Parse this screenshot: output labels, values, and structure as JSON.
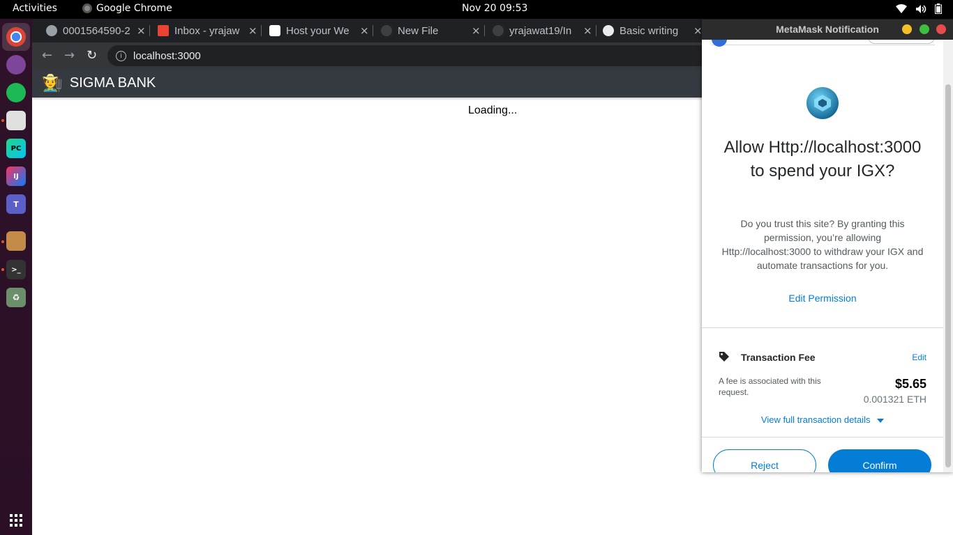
{
  "topbar": {
    "activities": "Activities",
    "app_name": "Google Chrome",
    "clock": "Nov 20  09:53"
  },
  "dock": {
    "items": [
      "chrome-icon",
      "tor-browser-icon",
      "spotify-icon",
      "files-icon",
      "pycharm-icon",
      "intellij-icon",
      "teams-icon",
      "package-icon",
      "terminal-icon",
      "trash-icon"
    ],
    "app_grid": "show-applications-icon"
  },
  "browser": {
    "tabs": [
      {
        "title": "0001564590-2"
      },
      {
        "title": "Inbox - yrajaw"
      },
      {
        "title": "Host your We"
      },
      {
        "title": "New File"
      },
      {
        "title": "yrajawat19/In"
      },
      {
        "title": "Basic writing"
      }
    ],
    "tab_close": "×",
    "url": "localhost:3000"
  },
  "page": {
    "brand_emoji": "🧑‍🌾",
    "brand": "SIGMA BANK",
    "loading": "Loading..."
  },
  "metamask": {
    "window_title": "MetaMask Notification",
    "heading": "Allow Http://localhost:3000 to spend your IGX?",
    "description": "Do you trust this site? By granting this permission, you’re allowing Http://localhost:3000 to withdraw your IGX and automate transactions for you.",
    "edit_permission": "Edit Permission",
    "fee": {
      "label": "Transaction Fee",
      "edit": "Edit",
      "note": "A fee is associated with this request.",
      "usd": "$5.65",
      "eth": "0.001321 ETH"
    },
    "view_details": "View full transaction details",
    "reject": "Reject",
    "confirm": "Confirm"
  }
}
